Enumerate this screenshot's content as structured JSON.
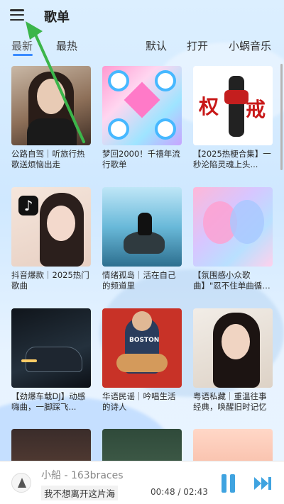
{
  "header": {
    "title": "歌单"
  },
  "tabs": [
    {
      "label": "最新"
    },
    {
      "label": "最热"
    },
    {
      "label": "默认"
    },
    {
      "label": "打开"
    },
    {
      "label": "小蜗音乐"
    }
  ],
  "playlists": [
    {
      "caption": "公路自驾｜听旅行热歌送烦恼出走"
    },
    {
      "caption": "梦回2000！千禧年流行歌单"
    },
    {
      "caption": "【2025热梗合集】一秒沦陷灵魂上头..."
    },
    {
      "caption": "抖音爆款｜2025热门歌曲"
    },
    {
      "caption": "情绪孤岛｜活在自己的频道里"
    },
    {
      "caption": "【氛围感小众歌曲】\"忍不住单曲循环！\""
    },
    {
      "caption": "【劲爆车载DJ】动感嗨曲，一脚踩飞..."
    },
    {
      "caption": "华语民谣｜吟唱生活的诗人"
    },
    {
      "caption": "粤语私藏｜重温往事经典，唤醒旧时记忆"
    }
  ],
  "thumb_text": {
    "hero_kanji_1": "权",
    "hero_kanji_2": "戒",
    "tiktok_logo": "♪",
    "guitar_shirt": "BOSTON"
  },
  "player": {
    "song": "小船 - 163braces",
    "lyric": "我不想离开这片海",
    "time": "00:48 / 02:43"
  },
  "colors": {
    "accent": "#3a8bff",
    "player_controls": "#3fa3e0",
    "annotation_arrow": "#3bb54a"
  },
  "icons": {
    "menu": "menu-icon",
    "pause": "pause-icon",
    "next": "next-icon",
    "arrow": "annotation-arrow"
  }
}
